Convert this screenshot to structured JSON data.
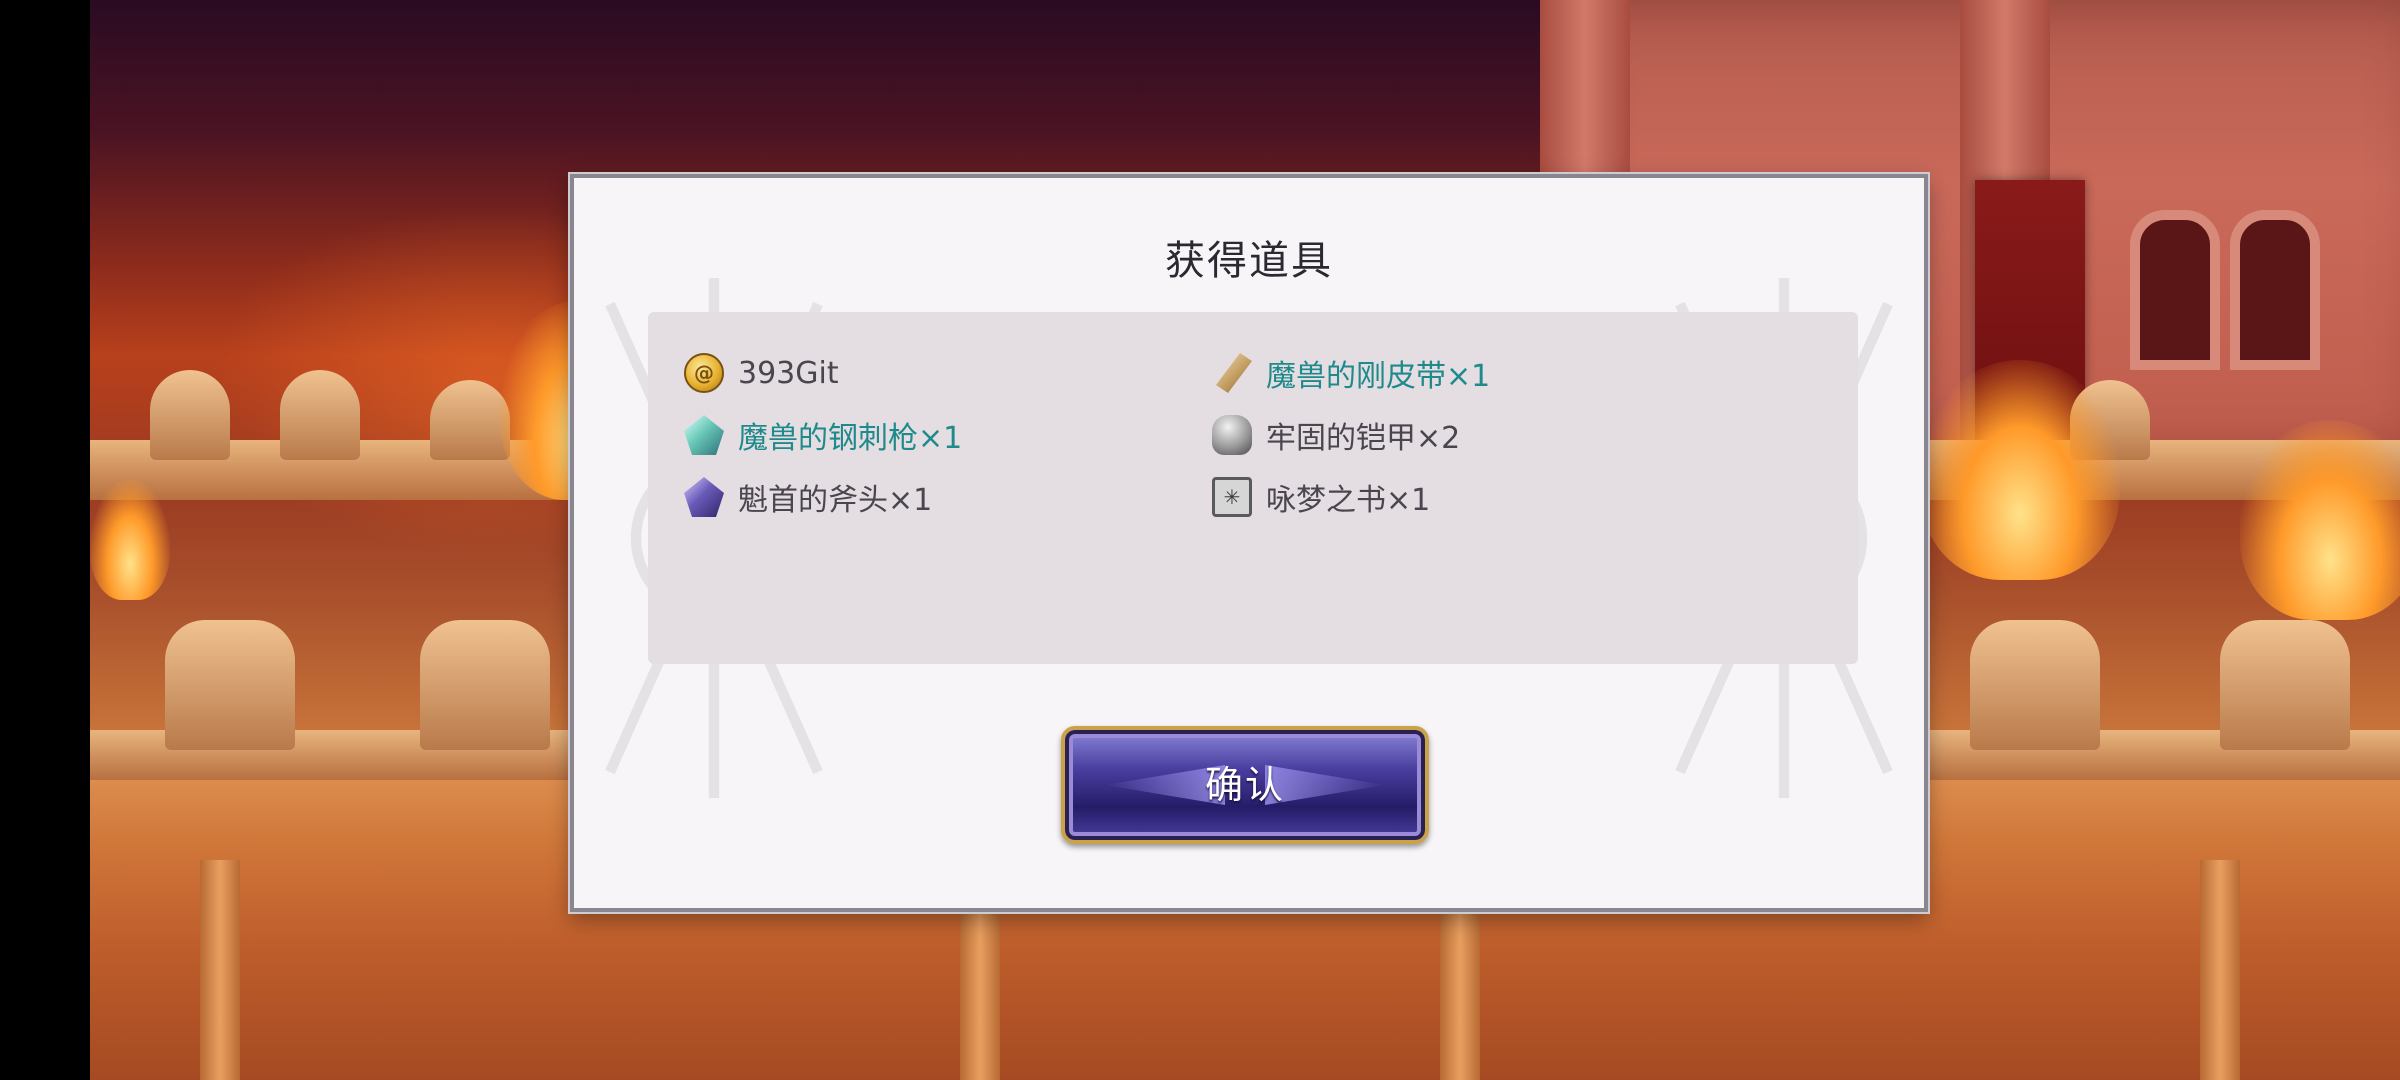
{
  "dialog": {
    "title": "获得道具",
    "confirm_label": "确认"
  },
  "items": [
    {
      "icon": "gold-coin-icon",
      "text": "393Git",
      "rare": false
    },
    {
      "icon": "leather-belt-icon",
      "text": "魔兽的刚皮带×1",
      "rare": true
    },
    {
      "icon": "teal-crystal-icon",
      "text": "魔兽的钢刺枪×1",
      "rare": true
    },
    {
      "icon": "steel-armor-icon",
      "text": "牢固的铠甲×2",
      "rare": false
    },
    {
      "icon": "purple-crystal-icon",
      "text": "魁首的斧头×1",
      "rare": false
    },
    {
      "icon": "dream-book-icon",
      "text": "咏梦之书×1",
      "rare": false
    }
  ],
  "colors": {
    "rare_item": "#1f8a8c",
    "normal_item": "#4a4650",
    "button_gold_border": "#c9a24a",
    "button_purple": "#4a3fa0"
  }
}
